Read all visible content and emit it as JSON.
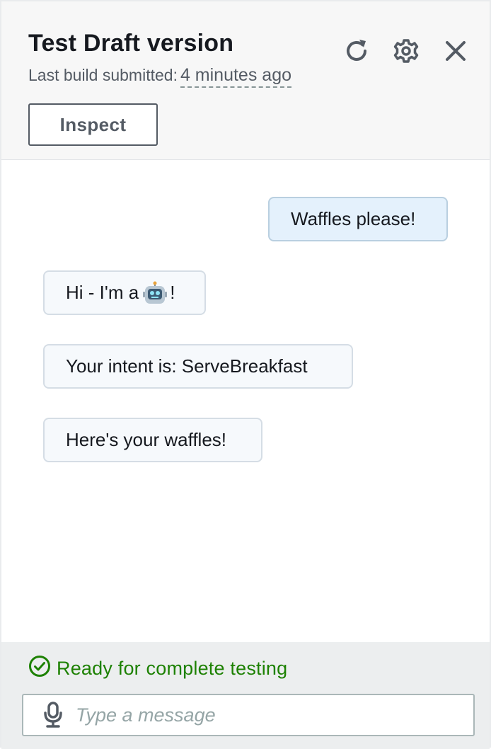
{
  "header": {
    "title": "Test Draft version",
    "subtitle_label": "Last build submitted:",
    "subtitle_time": "4 minutes ago",
    "inspect_label": "Inspect"
  },
  "messages": [
    {
      "sender": "user",
      "text": "Waffles please!"
    },
    {
      "sender": "bot",
      "text_before": "Hi - I'm a",
      "emoji": "robot-emoji",
      "text_after": "!"
    },
    {
      "sender": "bot",
      "text": "Your intent is: ServeBreakfast"
    },
    {
      "sender": "bot",
      "text": "Here's your waffles!"
    }
  ],
  "footer": {
    "status": "Ready for complete testing",
    "input_placeholder": "Type a message",
    "input_value": ""
  },
  "colors": {
    "status_green": "#1d8102",
    "user_bubble": "#e4f1fc",
    "bot_bubble": "#f6f9fc"
  }
}
